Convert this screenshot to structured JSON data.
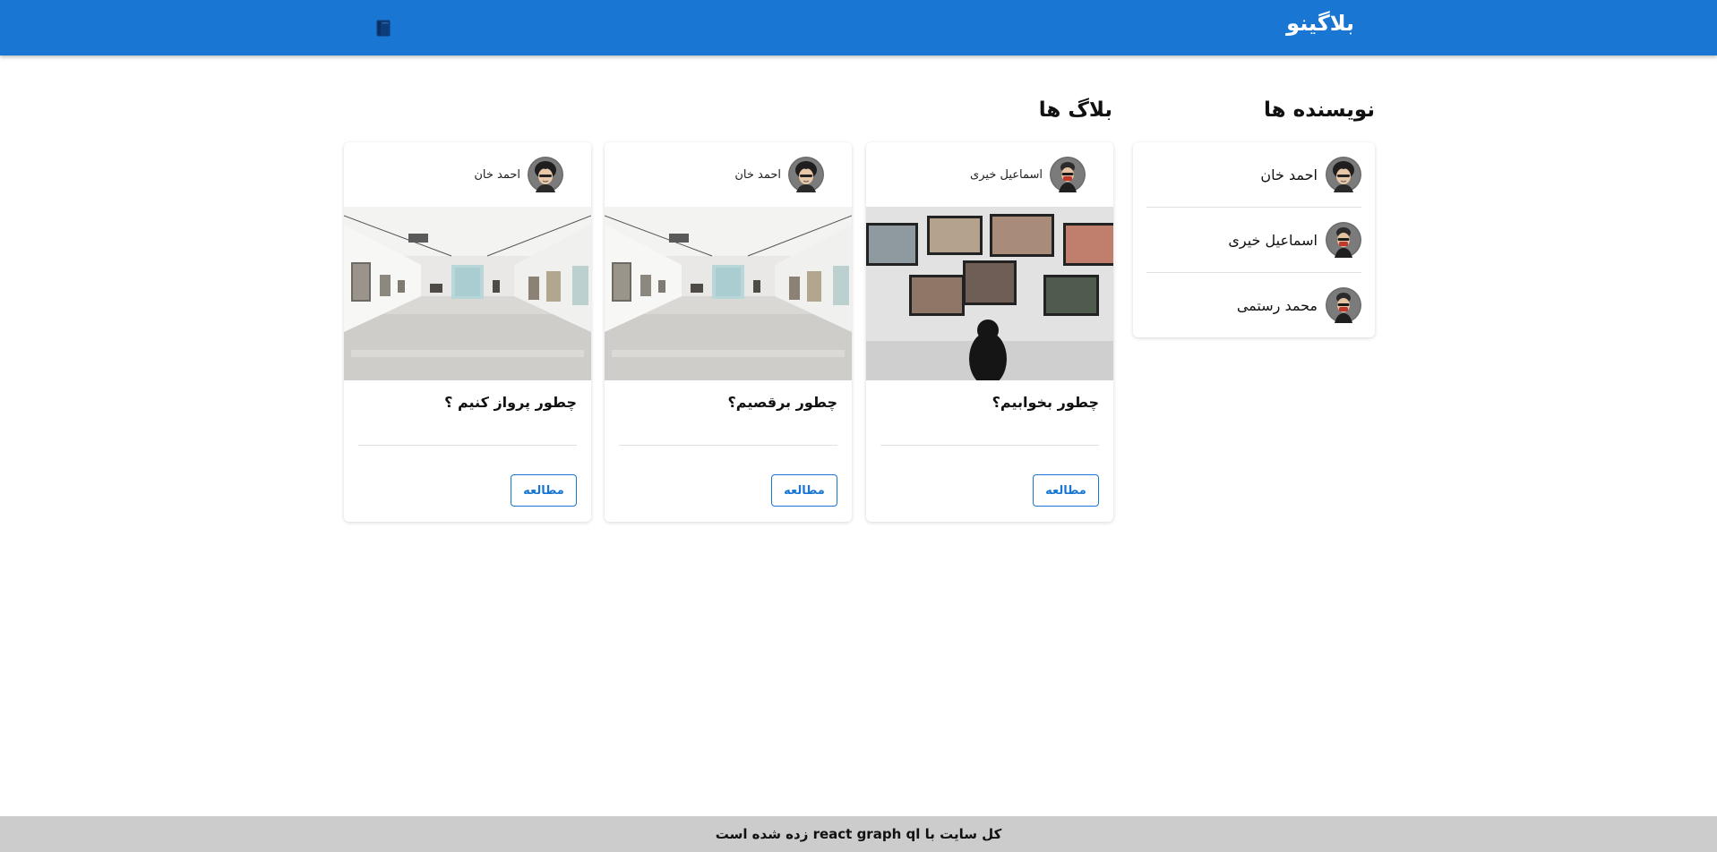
{
  "header": {
    "brand": "بلاگینو",
    "brand_color": "#1976d2",
    "menu_icon": "book-icon"
  },
  "authors": {
    "title": "نویسنده ها",
    "items": [
      {
        "name": "احمد خان"
      },
      {
        "name": "اسماعیل خیری"
      },
      {
        "name": "محمد رستمی"
      }
    ]
  },
  "blogs": {
    "title": "بلاگ ها",
    "cards": [
      {
        "author": "اسماعیل خیری",
        "title": "چطور بخوابیم؟",
        "button": "مطالعه",
        "image": "gallery-wall-photo"
      },
      {
        "author": "احمد خان",
        "title": "چطور برقصیم؟",
        "button": "مطالعه",
        "image": "gallery-hall-photo"
      },
      {
        "author": "احمد خان",
        "title": "چطور پرواز کنیم ؟",
        "button": "مطالعه",
        "image": "gallery-hall-photo"
      }
    ]
  },
  "footer": {
    "text": "کل سایت با react graph ql زده شده است"
  }
}
